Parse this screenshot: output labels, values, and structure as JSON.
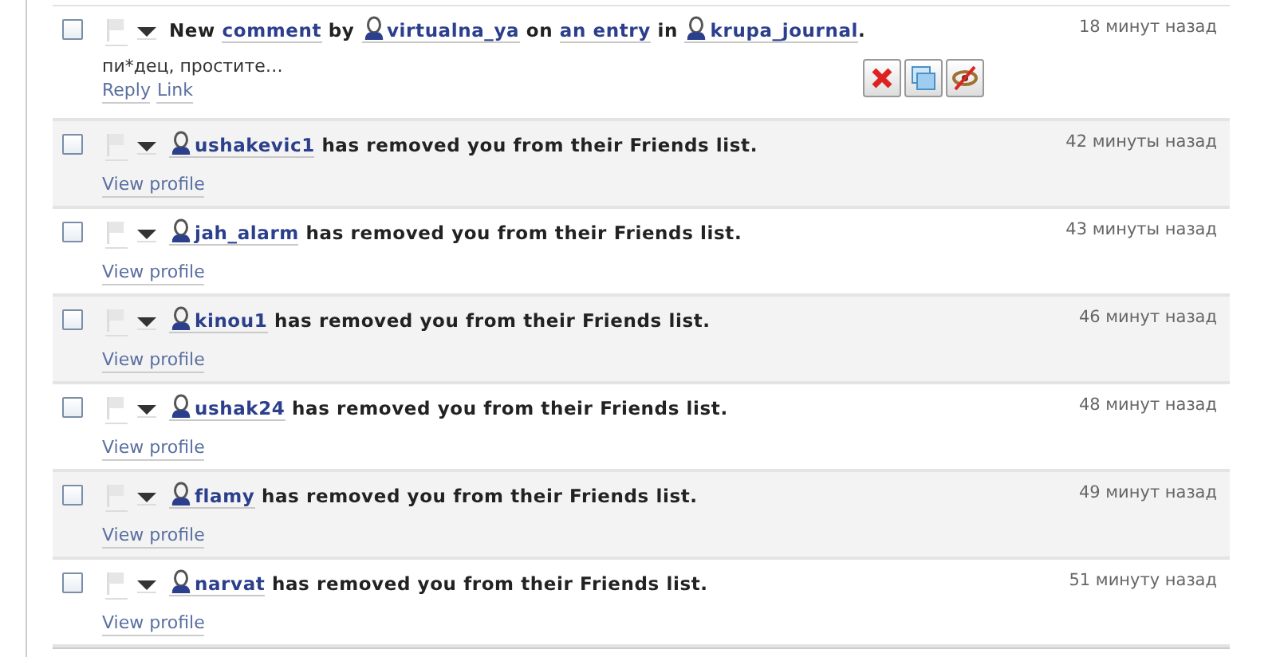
{
  "notifications": [
    {
      "kind": "comment",
      "checked": false,
      "message": [
        {
          "kind": "text",
          "text": "New"
        },
        {
          "kind": "link",
          "text": "comment"
        },
        {
          "kind": "text",
          "text": "by"
        },
        {
          "kind": "user",
          "text": "virtualna_ya"
        },
        {
          "kind": "text",
          "text": "on"
        },
        {
          "kind": "link",
          "text": "an entry"
        },
        {
          "kind": "text",
          "text": "in"
        },
        {
          "kind": "user",
          "text": "krupa_journal"
        },
        {
          "kind": "text",
          "text": "."
        }
      ],
      "time": "18 минут назад",
      "excerpt": "пи*дец, простите…",
      "actions": [
        "Reply",
        "Link"
      ]
    },
    {
      "kind": "friend",
      "checked": false,
      "message": [
        {
          "kind": "user",
          "text": "ushakevic1"
        },
        {
          "kind": "text",
          "text": "has removed you from their Friends list."
        }
      ],
      "time": "42 минуты назад",
      "actions": [
        "View profile"
      ]
    },
    {
      "kind": "friend",
      "checked": false,
      "message": [
        {
          "kind": "user",
          "text": "jah_alarm"
        },
        {
          "kind": "text",
          "text": "has removed you from their Friends list."
        }
      ],
      "time": "43 минуты назад",
      "actions": [
        "View profile"
      ]
    },
    {
      "kind": "friend",
      "checked": false,
      "message": [
        {
          "kind": "user",
          "text": "kinou1"
        },
        {
          "kind": "text",
          "text": "has removed you from their Friends list."
        }
      ],
      "time": "46 минут назад",
      "actions": [
        "View profile"
      ]
    },
    {
      "kind": "friend",
      "checked": false,
      "message": [
        {
          "kind": "user",
          "text": "ushak24"
        },
        {
          "kind": "text",
          "text": "has removed you from their Friends list."
        }
      ],
      "time": "48 минут назад",
      "actions": [
        "View profile"
      ]
    },
    {
      "kind": "friend",
      "checked": false,
      "message": [
        {
          "kind": "user",
          "text": "flamy"
        },
        {
          "kind": "text",
          "text": "has removed you from their Friends list."
        }
      ],
      "time": "49 минут назад",
      "actions": [
        "View profile"
      ]
    },
    {
      "kind": "friend",
      "checked": false,
      "message": [
        {
          "kind": "user",
          "text": "narvat"
        },
        {
          "kind": "text",
          "text": "has removed you from their Friends list."
        }
      ],
      "time": "51 минуту назад",
      "actions": [
        "View profile"
      ]
    }
  ]
}
